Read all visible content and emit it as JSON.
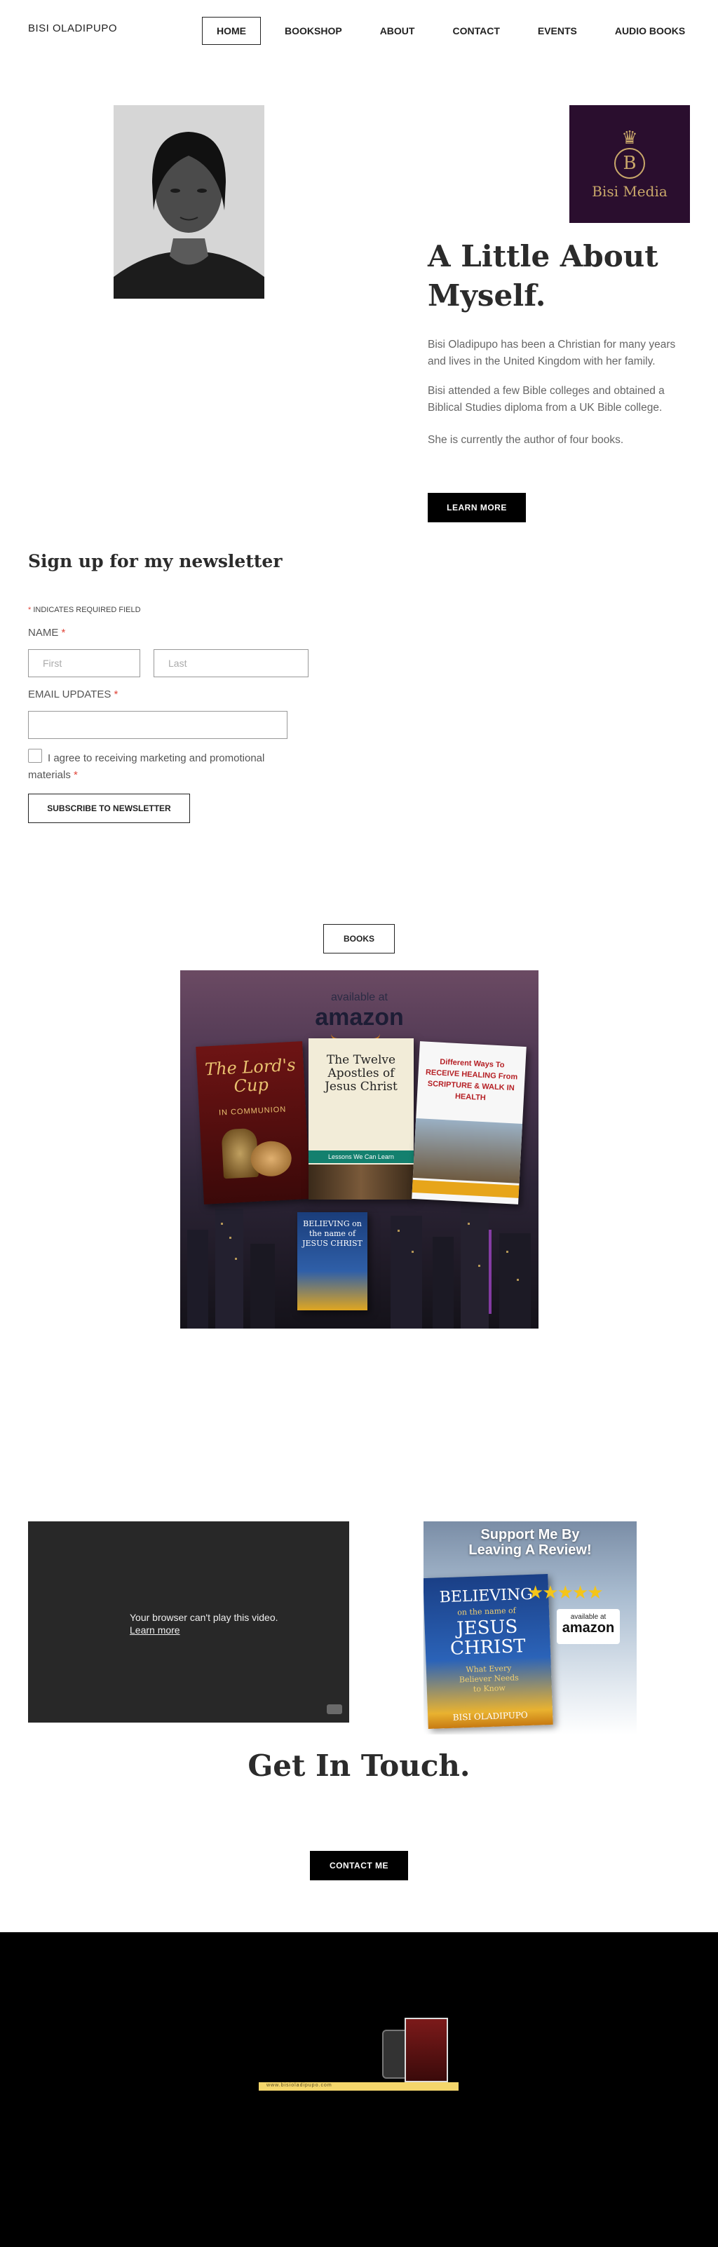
{
  "header": {
    "brand": "BISI OLADIPUPO",
    "nav": [
      {
        "label": "HOME",
        "active": true
      },
      {
        "label": "BOOKSHOP",
        "active": false
      },
      {
        "label": "ABOUT",
        "active": false
      },
      {
        "label": "CONTACT",
        "active": false
      },
      {
        "label": "EVENTS",
        "active": false
      },
      {
        "label": "AUDIO BOOKS",
        "active": false
      }
    ]
  },
  "logo": {
    "letter": "B",
    "text": "Bisi Media"
  },
  "about": {
    "title": "A Little About Myself.",
    "paragraphs": [
      "Bisi Oladipupo has been a Christian for many years and lives in the United Kingdom with her family.",
      "Bisi attended a few Bible colleges and obtained a Biblical Studies diploma from a UK Bible college.",
      "She is currently the author of four books."
    ],
    "button": "LEARN MORE"
  },
  "newsletter": {
    "title": "Sign up for my newsletter",
    "required_note": "INDICATES REQUIRED FIELD",
    "name_label": "NAME",
    "first_placeholder": "First",
    "last_placeholder": "Last",
    "email_label": "EMAIL UPDATES",
    "email_value": "",
    "consent": "I agree to receiving marketing and promotional materials",
    "consent_checked": false,
    "submit": "SUBSCRIBE TO NEWSLETTER"
  },
  "books": {
    "button": "BOOKS",
    "promo": {
      "available": "available at",
      "store": "amazon",
      "titles": [
        {
          "title": "The Lord's Cup",
          "subtitle": "IN COMMUNION"
        },
        {
          "title": "The Twelve Apostles of Jesus Christ",
          "subtitle": "Lessons We Can Learn"
        },
        {
          "title": "Different Ways To RECEIVE HEALING From SCRIPTURE & WALK IN HEALTH",
          "subtitle": ""
        },
        {
          "title": "BELIEVING on the name of JESUS CHRIST",
          "subtitle": ""
        }
      ]
    }
  },
  "video": {
    "message": "Your browser can't play this video.",
    "link": "Learn more"
  },
  "review_promo": {
    "heading": "Support Me By Leaving A Review!",
    "book_title_1": "BELIEVING",
    "book_title_2": "on the name of",
    "book_title_3": "JESUS CHRIST",
    "book_subtitle": "What Every Believer Needs to Know",
    "author": "BISI OLADIPUPO",
    "stars": 5,
    "available": "available at",
    "store": "amazon"
  },
  "contact": {
    "title": "Get In Touch.",
    "button": "CONTACT ME"
  },
  "footer": {
    "bar_text": "www.bisioladipupo.com"
  }
}
